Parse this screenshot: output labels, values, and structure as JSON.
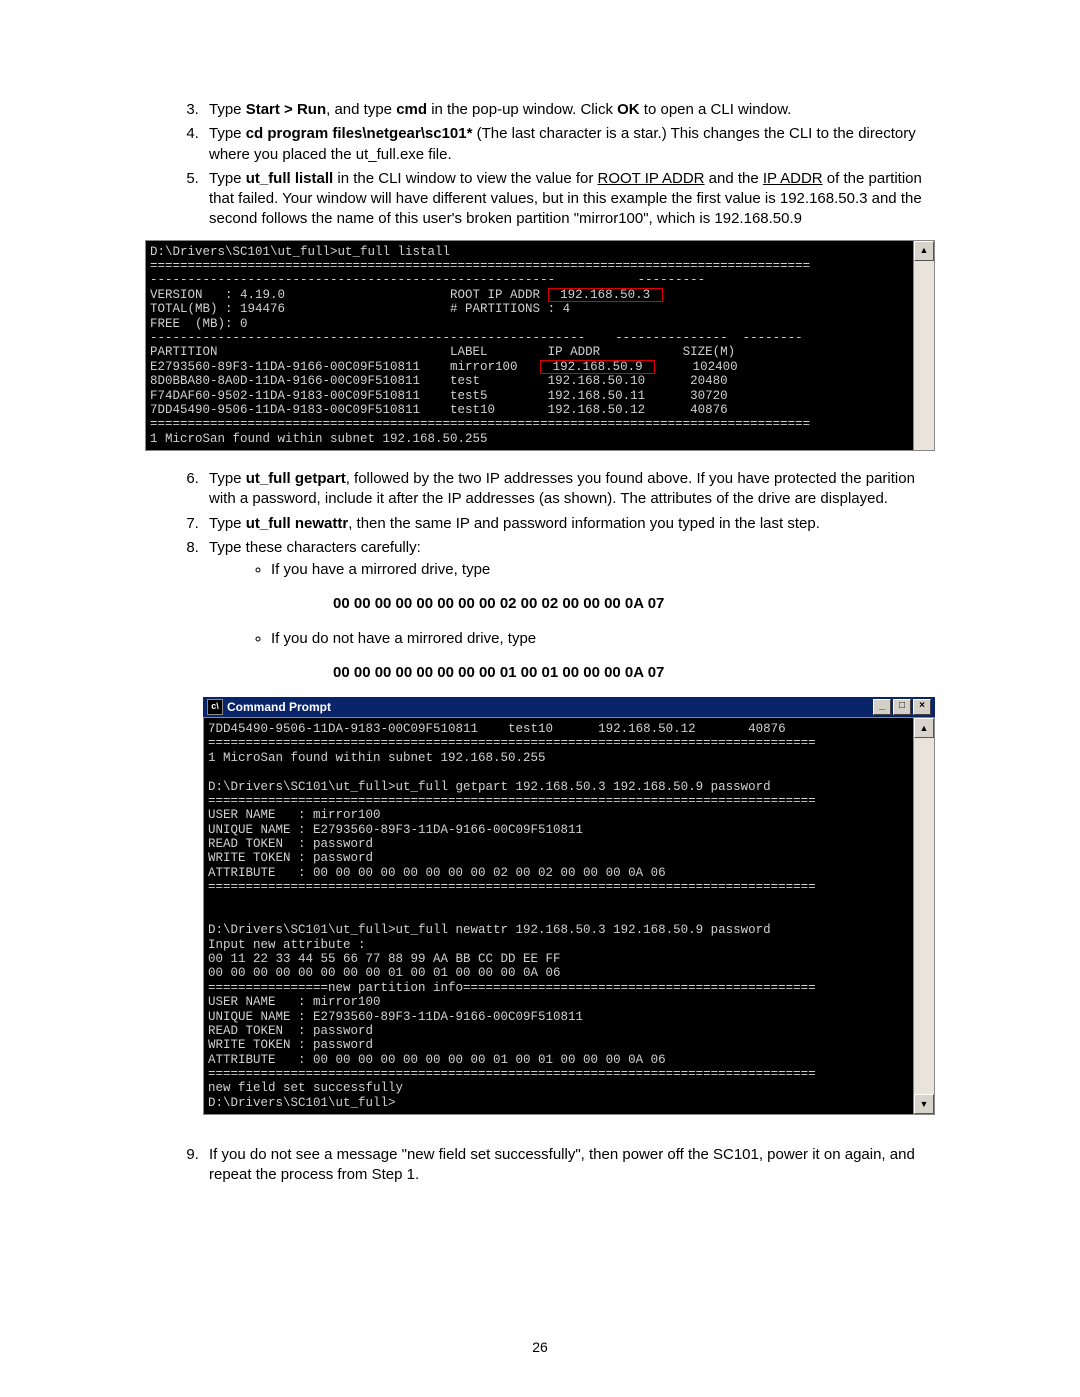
{
  "steps": {
    "s3": {
      "pre": "Type ",
      "cmd1": "Start > Run",
      "mid1": ", and type ",
      "cmd2": "cmd",
      "mid2": " in the pop-up window. Click ",
      "cmd3": "OK",
      "post": " to open a CLI window."
    },
    "s4": {
      "pre": "Type ",
      "cmd": "cd program files\\netgear\\sc101*",
      "post": " (The last character is a star.) This changes the CLI to the directory where you placed the ut_full.exe file."
    },
    "s5": {
      "pre": "Type ",
      "cmd": "ut_full listall",
      "mid1": " in the CLI window to view the value for ",
      "u1": "ROOT IP ADDR",
      "mid2": " and the ",
      "u2": "IP ADDR",
      "post": " of the partition that failed. Your window will have different values, but in this example the first value is 192.168.50.3 and the second follows the name of this user's broken partition \"mirror100\", which is 192.168.50.9"
    },
    "s6": {
      "pre": "Type ",
      "cmd": "ut_full getpart",
      "post": ", followed by the two IP addresses you found above. If you have protected the parition with a password, include it after the IP addresses (as shown). The attributes of the drive are displayed."
    },
    "s7": {
      "pre": "Type ",
      "cmd": "ut_full newattr",
      "post": ", then the same IP and password information you typed in the last step."
    },
    "s8": {
      "text": "Type these characters carefully:",
      "sub1": "If you have a mirrored drive, type",
      "code1": "00 00 00 00 00 00 00 00 02 00 02 00 00 00 0A 07",
      "sub2": "If you do not have a mirrored drive, type",
      "code2": "00 00 00 00 00 00 00 00 01 00 01 00 00 00 0A 07"
    },
    "s9": {
      "text": "If you do not see a message \"new field set successfully\", then power off the SC101, power it on again, and repeat the process from Step 1."
    }
  },
  "term1": {
    "l1": "D:\\Drivers\\SC101\\ut_full>ut_full listall",
    "l2": "========================================================================================",
    "l3": "------------------------------------------------------           ---------",
    "l4a": "VERSION   : 4.19.0                      ROOT IP ADDR ",
    "l4b": " 192.168.50.3 ",
    "l5": "TOTAL(MB) : 194476                      # PARTITIONS : 4",
    "l6": "FREE  (MB): 0",
    "l7": "----------------------------------------------------------    ---------------  --------",
    "pH": "PARTITION                               LABEL        IP ADDR           SIZE(M)",
    "p1a": "E2793560-89F3-11DA-9166-00C09F510811    mirror100   ",
    "p1b": " 192.168.50.9 ",
    "p1c": "     102400",
    "p2": "8D0BBA80-8A0D-11DA-9166-00C09F510811    test         192.168.50.10      20480",
    "p3": "F74DAF60-9502-11DA-9183-00C09F510811    test5        192.168.50.11      30720",
    "p4": "7DD45490-9506-11DA-9183-00C09F510811    test10       192.168.50.12      40876",
    "l8": "========================================================================================",
    "l9": "1 MicroSan found within subnet 192.168.50.255"
  },
  "cmdwin": {
    "title": "Command Prompt",
    "lines": [
      "7DD45490-9506-11DA-9183-00C09F510811    test10      192.168.50.12       40876",
      "=================================================================================",
      "1 MicroSan found within subnet 192.168.50.255",
      "",
      "D:\\Drivers\\SC101\\ut_full>ut_full getpart 192.168.50.3 192.168.50.9 password",
      "=================================================================================",
      "USER NAME   : mirror100",
      "UNIQUE NAME : E2793560-89F3-11DA-9166-00C09F510811",
      "READ TOKEN  : password",
      "WRITE TOKEN : password",
      "ATTRIBUTE   : 00 00 00 00 00 00 00 00 02 00 02 00 00 00 0A 06",
      "=================================================================================",
      "",
      "",
      "D:\\Drivers\\SC101\\ut_full>ut_full newattr 192.168.50.3 192.168.50.9 password",
      "Input new attribute :",
      "00 11 22 33 44 55 66 77 88 99 AA BB CC DD EE FF",
      "00 00 00 00 00 00 00 00 01 00 01 00 00 00 0A 06",
      "================new partition info===============================================",
      "USER NAME   : mirror100",
      "UNIQUE NAME : E2793560-89F3-11DA-9166-00C09F510811",
      "READ TOKEN  : password",
      "WRITE TOKEN : password",
      "ATTRIBUTE   : 00 00 00 00 00 00 00 00 01 00 01 00 00 00 0A 06",
      "=================================================================================",
      "new field set successfully",
      "D:\\Drivers\\SC101\\ut_full>"
    ]
  },
  "page_number": "26"
}
